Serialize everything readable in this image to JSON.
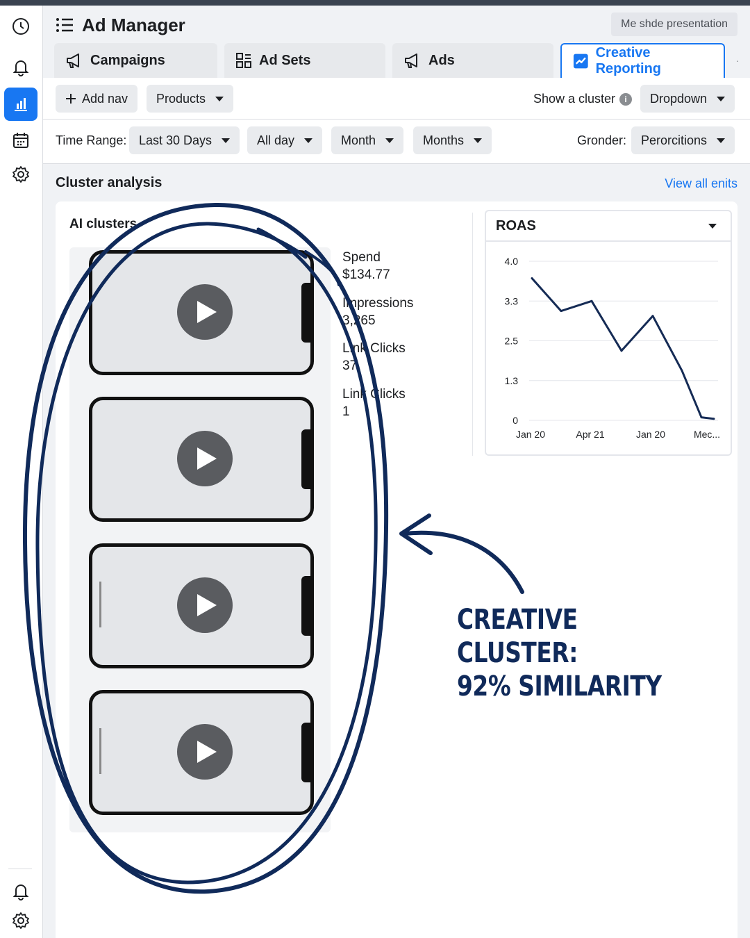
{
  "header": {
    "title": "Ad Manager",
    "presentation_button": "Me shde presentation"
  },
  "tabs": [
    {
      "label": "Campaigns",
      "icon": "megaphone-icon"
    },
    {
      "label": "Ad Sets",
      "icon": "grid-icon"
    },
    {
      "label": "Ads",
      "icon": "megaphone-icon"
    },
    {
      "label": "Creative Reporting",
      "icon": "chart-icon",
      "active": true
    }
  ],
  "toolbar1": {
    "add_nav": "Add nav",
    "products": "Products",
    "show_cluster_label": "Show a cluster",
    "dropdown": "Dropdown"
  },
  "toolbar2": {
    "time_range_label": "Time Range:",
    "time_range": "Last 30 Days",
    "day": "All day",
    "month": "Month",
    "months": "Months",
    "gronder_label": "Gronder:",
    "gronder": "Perorcitions"
  },
  "section": {
    "title": "Cluster analysis",
    "view_all": "View all enits",
    "card_label": "AI clusters"
  },
  "metrics": [
    {
      "label": "Spend",
      "value": "$134.77"
    },
    {
      "label": "Impressions",
      "value": "3,265"
    },
    {
      "label": "Link Clicks",
      "value": "37"
    },
    {
      "label": "Link Clicks",
      "value": "1"
    }
  ],
  "chart_data": {
    "type": "line",
    "title": "ROAS",
    "x_tick_labels": [
      "Jan 20",
      "Apr 21",
      "Jan 20",
      "Mec..."
    ],
    "y_tick_labels": [
      "4.0",
      "3.3",
      "2.5",
      "1.3",
      "0"
    ],
    "ylim": [
      0,
      4.0
    ],
    "grid": true,
    "series": [
      {
        "values": [
          3.7,
          3.1,
          3.3,
          2.2,
          3.0,
          1.6,
          0.1,
          0.05
        ]
      }
    ],
    "colors": {
      "line": "#152b55",
      "grid": "#e4e6eb"
    }
  },
  "annotation": {
    "line1": "CREATIVE CLUSTER:",
    "line2": "92% SIMILARITY",
    "color": "#102a5a"
  },
  "colors": {
    "accent": "#1877f2",
    "ink": "#102a5a"
  }
}
